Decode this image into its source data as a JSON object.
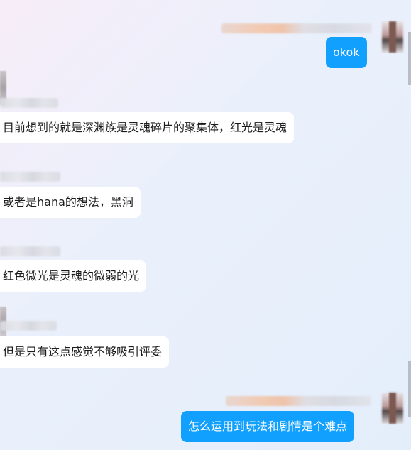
{
  "messages": [
    {
      "side": "out",
      "text": "okok"
    },
    {
      "side": "in",
      "text": "目前想到的就是深渊族是灵魂碎片的聚集体，红光是灵魂"
    },
    {
      "side": "in",
      "text": "或者是hana的想法，黑洞"
    },
    {
      "side": "in",
      "text": "红色微光是灵魂的微弱的光"
    },
    {
      "side": "in",
      "text": "但是只有这点感觉不够吸引评委"
    },
    {
      "side": "out",
      "text": "怎么运用到玩法和剧情是个难点"
    }
  ],
  "colors": {
    "outgoing_bubble": "#12a0ff",
    "incoming_bubble": "#ffffff",
    "incoming_text": "#1b1b1b"
  }
}
